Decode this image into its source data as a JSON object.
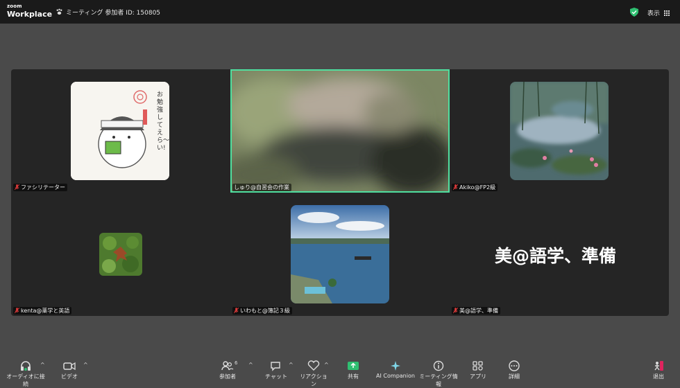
{
  "brand": {
    "line1": "zoom",
    "line2": "Workplace"
  },
  "meeting": {
    "info": "ミーティング 参加者 ID: 150805"
  },
  "header": {
    "view_label": "表示"
  },
  "participants": [
    {
      "name": "ファシリテーター"
    },
    {
      "name": "しゅり@自習会の作業"
    },
    {
      "name": "Akiko@FP2級"
    },
    {
      "name": "kenta@薬学と英語"
    },
    {
      "name": "いわもと@簿記３級"
    },
    {
      "name": "美@語学、準備",
      "display_name": "美@語学、準備"
    }
  ],
  "sticker_text": "お勉強して えら〜い!",
  "toolbar": {
    "audio": "オーディオに接続",
    "video": "ビデオ",
    "participants": "参加者",
    "participants_count": "6",
    "chat": "チャット",
    "reactions": "リアクション",
    "share": "共有",
    "ai": "AI Companion",
    "meeting_info": "ミーティング情報",
    "apps": "アプリ",
    "more": "詳細",
    "leave": "退出"
  },
  "colors": {
    "accent": "#4fe0a0",
    "leave": "#e0245e",
    "share": "#2fbf71"
  }
}
